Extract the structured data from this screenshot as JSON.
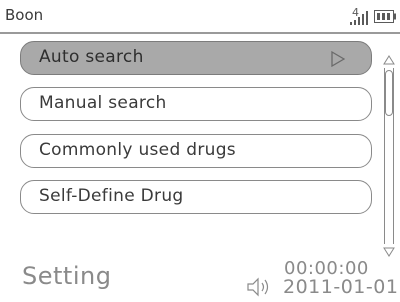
{
  "header": {
    "title": "Boon",
    "signal_label": "4",
    "signal_icon": "signal-strength-icon",
    "battery_icon": "battery-icon"
  },
  "menu": {
    "items": [
      {
        "label": "Auto search",
        "selected": true,
        "icon": "play-arrow-icon"
      },
      {
        "label": "Manual search",
        "selected": false
      },
      {
        "label": "Commonly used drugs",
        "selected": false
      },
      {
        "label": "Self-Define Drug",
        "selected": false
      }
    ]
  },
  "footer": {
    "page_title": "Setting",
    "time": "00:00:00",
    "date": "2011-01-01",
    "speaker_icon": "speaker-icon"
  },
  "colors": {
    "selected_bg": "#a9a9a9",
    "border": "#8a8a8a",
    "text": "#3a3a3a",
    "footer_text": "#8a8a8a"
  }
}
